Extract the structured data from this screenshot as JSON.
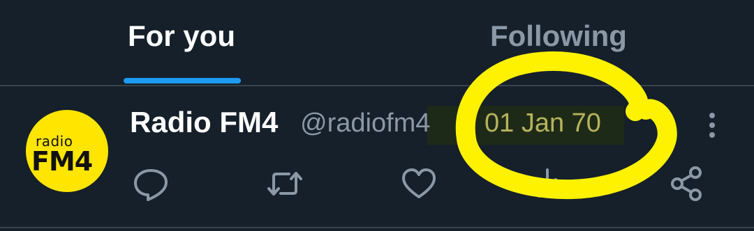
{
  "tabs": [
    {
      "label": "For you",
      "active": true
    },
    {
      "label": "Following",
      "active": false
    }
  ],
  "tweet": {
    "avatar": {
      "line1": "radio",
      "line2": "FM4",
      "color": "#ffe500"
    },
    "author_name": "Radio FM4",
    "author_handle": "@radiofm4",
    "date": "01 Jan 70",
    "actions": [
      {
        "name": "reply",
        "icon": "speech-bubble-icon"
      },
      {
        "name": "retweet",
        "icon": "retweet-arrows-icon"
      },
      {
        "name": "like",
        "icon": "heart-icon"
      },
      {
        "name": "views",
        "icon": "bar-chart-icon"
      },
      {
        "name": "share",
        "icon": "share-icon"
      }
    ]
  },
  "colors": {
    "background": "#15202b",
    "accent": "#1d9bf0",
    "muted_text": "#8b98a5",
    "annotation": "#fff200"
  }
}
